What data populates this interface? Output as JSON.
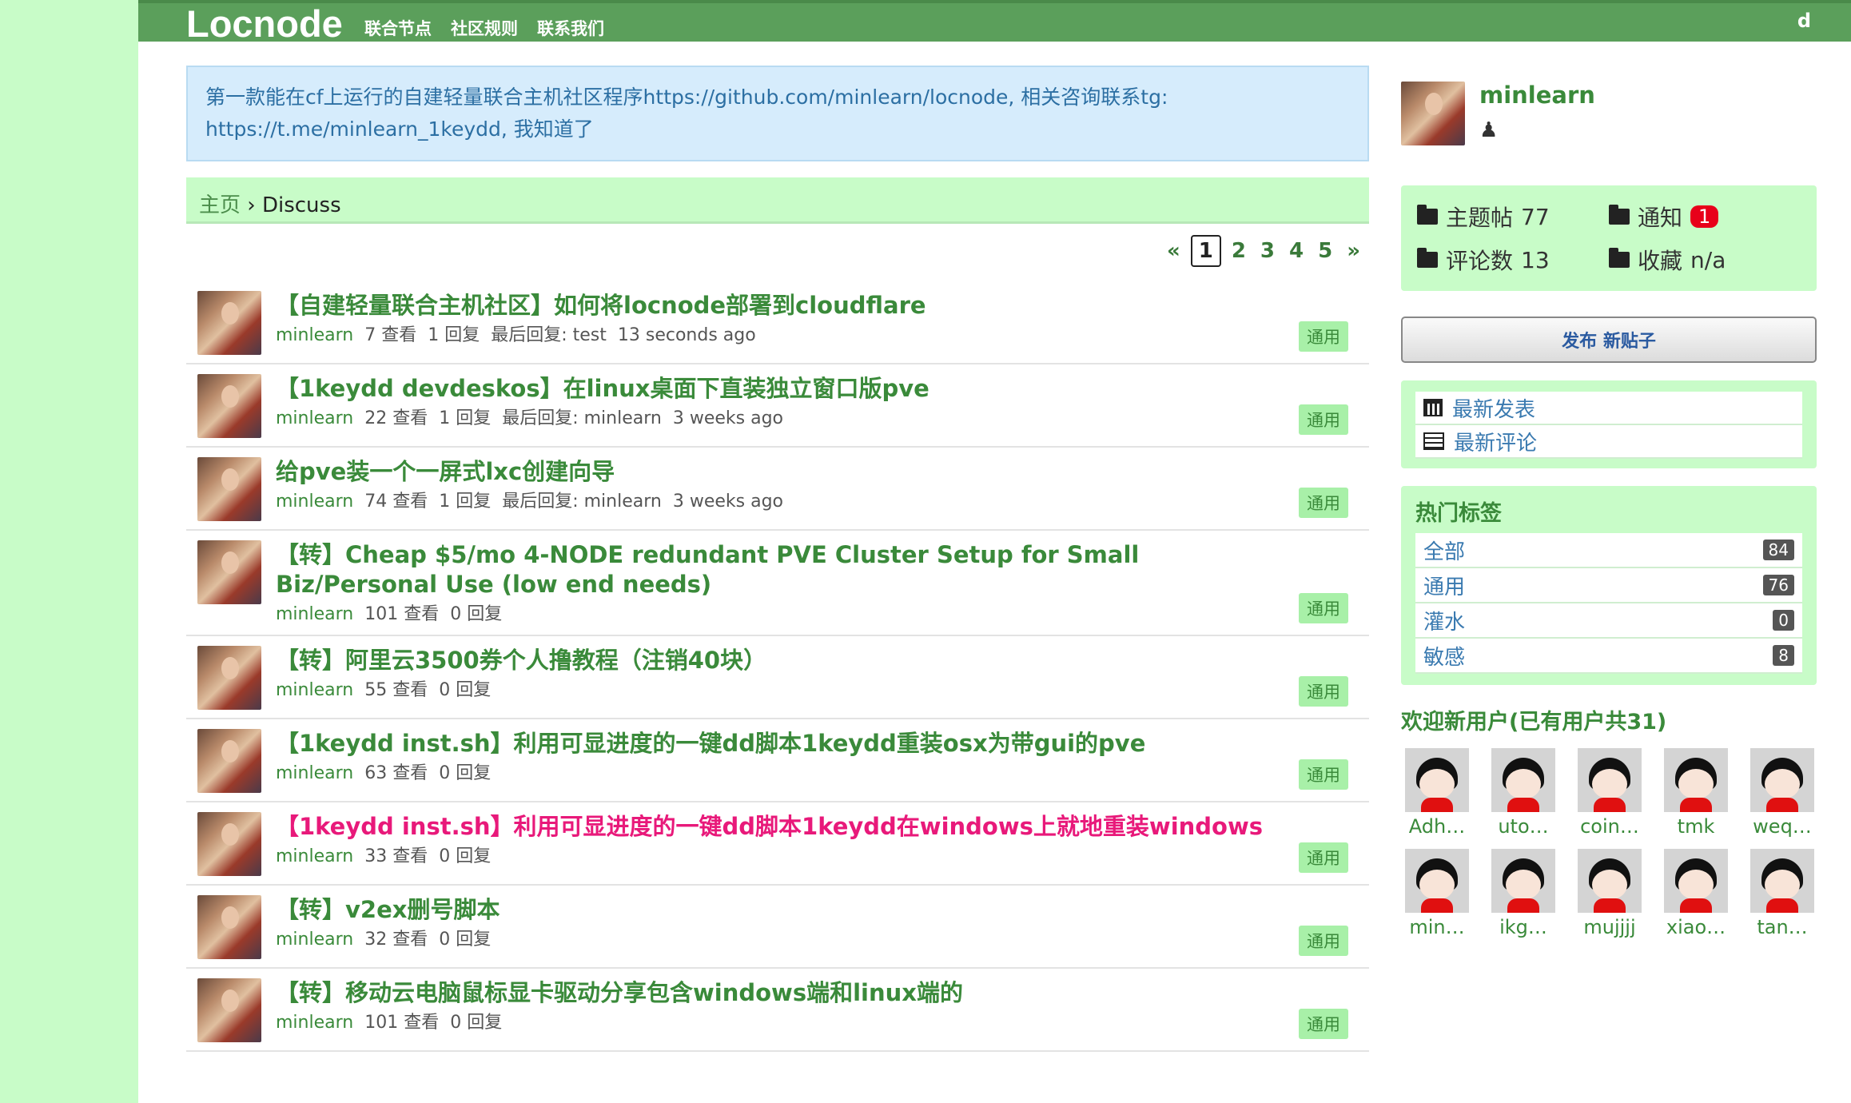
{
  "header": {
    "brand": "Locnode",
    "nav": [
      "联合节点",
      "社区规则",
      "联系我们"
    ],
    "user": "d"
  },
  "notice": "第一款能在cf上运行的自建轻量联合主机社区程序https://github.com/minlearn/locnode, 相关咨询联系tg: https://t.me/minlearn_1keydd, 我知道了",
  "breadcrumb": {
    "home": "主页",
    "sep": " › ",
    "current": "Discuss"
  },
  "pager": {
    "prev": "«",
    "pages": [
      "1",
      "2",
      "3",
      "4",
      "5"
    ],
    "current": "1",
    "next": "»"
  },
  "topics": [
    {
      "title": "【自建轻量联合主机社区】如何将locnode部署到cloudflare",
      "author": "minlearn",
      "views": "7 查看",
      "replies": "1 回复",
      "last": "最后回复: test",
      "time": "13 seconds ago",
      "tag": "通用",
      "hot": false
    },
    {
      "title": "【1keydd devdeskos】在linux桌面下直装独立窗口版pve",
      "author": "minlearn",
      "views": "22 查看",
      "replies": "1 回复",
      "last": "最后回复: minlearn",
      "time": "3 weeks ago",
      "tag": "通用",
      "hot": false
    },
    {
      "title": "给pve装一个一屏式lxc创建向导",
      "author": "minlearn",
      "views": "74 查看",
      "replies": "1 回复",
      "last": "最后回复: minlearn",
      "time": "3 weeks ago",
      "tag": "通用",
      "hot": false
    },
    {
      "title": "【转】Cheap $5/mo 4-NODE redundant PVE Cluster Setup for Small Biz/Personal Use (low end needs)",
      "author": "minlearn",
      "views": "101 查看",
      "replies": "0 回复",
      "last": "",
      "time": "",
      "tag": "通用",
      "hot": false
    },
    {
      "title": "【转】阿里云3500券个人撸教程（注销40块）",
      "author": "minlearn",
      "views": "55 查看",
      "replies": "0 回复",
      "last": "",
      "time": "",
      "tag": "通用",
      "hot": false
    },
    {
      "title": "【1keydd inst.sh】利用可显进度的一键dd脚本1keydd重装osx为带gui的pve",
      "author": "minlearn",
      "views": "63 查看",
      "replies": "0 回复",
      "last": "",
      "time": "",
      "tag": "通用",
      "hot": false
    },
    {
      "title": "【1keydd inst.sh】利用可显进度的一键dd脚本1keydd在windows上就地重装windows",
      "author": "minlearn",
      "views": "33 查看",
      "replies": "0 回复",
      "last": "",
      "time": "",
      "tag": "通用",
      "hot": true
    },
    {
      "title": "【转】v2ex删号脚本",
      "author": "minlearn",
      "views": "32 查看",
      "replies": "0 回复",
      "last": "",
      "time": "",
      "tag": "通用",
      "hot": false
    },
    {
      "title": "【转】移动云电脑鼠标显卡驱动分享包含windows端和linux端的",
      "author": "minlearn",
      "views": "101 查看",
      "replies": "0 回复",
      "last": "",
      "time": "",
      "tag": "通用",
      "hot": false
    }
  ],
  "sidebar": {
    "username": "minlearn",
    "stats": {
      "topics_label": "主题帖",
      "topics": "77",
      "notify_label": "通知",
      "notify": "1",
      "comments_label": "评论数",
      "comments": "13",
      "fav_label": "收藏",
      "fav": "n/a"
    },
    "post_button": "发布 新贴子",
    "links": [
      "最新发表",
      "最新评论"
    ],
    "hot_tags_title": "热门标签",
    "hot_tags": [
      {
        "name": "全部",
        "count": "84"
      },
      {
        "name": "通用",
        "count": "76"
      },
      {
        "name": "灌水",
        "count": "0"
      },
      {
        "name": "敏感",
        "count": "8"
      }
    ],
    "new_users_title": "欢迎新用户(已有用户共31)",
    "new_users": [
      "Adh…",
      "uto…",
      "coin…",
      "tmk",
      "weq…",
      "min…",
      "ikg…",
      "mujjjj",
      "xiao…",
      "tan…"
    ]
  },
  "colors": {
    "accent": "#5b9f5b",
    "bg": "#c8fcc8",
    "hot": "#e8197a",
    "link": "#3a8a3a"
  }
}
